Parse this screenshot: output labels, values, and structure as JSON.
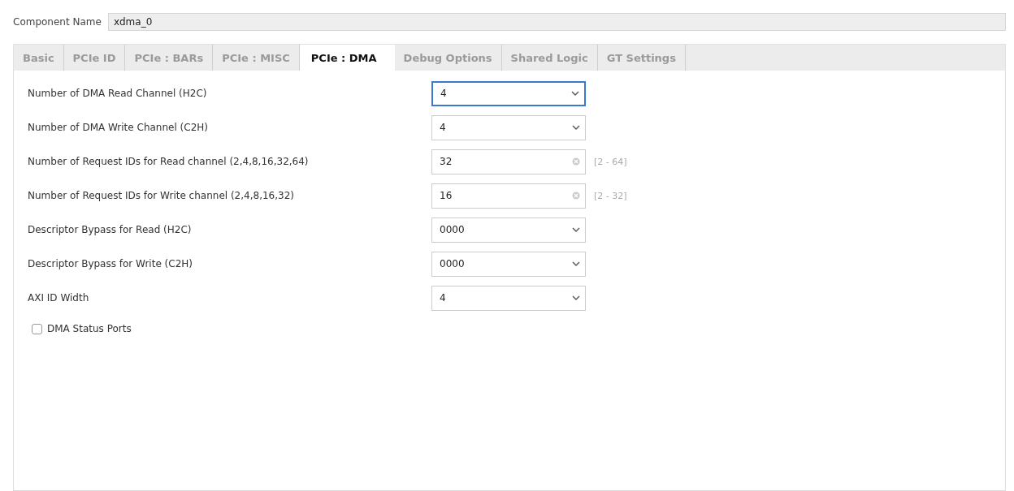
{
  "component_name": {
    "label": "Component Name",
    "value": "xdma_0"
  },
  "tabs": [
    {
      "label": "Basic",
      "selected": false
    },
    {
      "label": "PCIe ID",
      "selected": false
    },
    {
      "label": "PCIe : BARs",
      "selected": false
    },
    {
      "label": "PCIe : MISC",
      "selected": false
    },
    {
      "label": "PCIe : DMA",
      "selected": true
    },
    {
      "label": "Debug Options",
      "selected": false
    },
    {
      "label": "Shared Logic",
      "selected": false
    },
    {
      "label": "GT Settings",
      "selected": false
    }
  ],
  "fields": [
    {
      "kind": "dropdown",
      "label": "Number of DMA Read Channel (H2C)",
      "value": "4",
      "focused": true
    },
    {
      "kind": "dropdown",
      "label": "Number of DMA Write Channel (C2H)",
      "value": "4",
      "focused": false
    },
    {
      "kind": "text",
      "label": "Number of Request IDs for Read channel (2,4,8,16,32,64)",
      "value": "32",
      "range": "[2 - 64]",
      "focused": false
    },
    {
      "kind": "text",
      "label": "Number of Request IDs for Write channel (2,4,8,16,32)",
      "value": "16",
      "range": "[2 - 32]",
      "focused": false
    },
    {
      "kind": "dropdown",
      "label": "Descriptor Bypass for Read (H2C)",
      "value": "0000",
      "focused": false
    },
    {
      "kind": "dropdown",
      "label": "Descriptor Bypass for Write (C2H)",
      "value": "0000",
      "focused": false
    },
    {
      "kind": "dropdown",
      "label": "AXI ID Width",
      "value": "4",
      "focused": false
    }
  ],
  "checkbox": {
    "label": "DMA Status Ports",
    "checked": false
  }
}
